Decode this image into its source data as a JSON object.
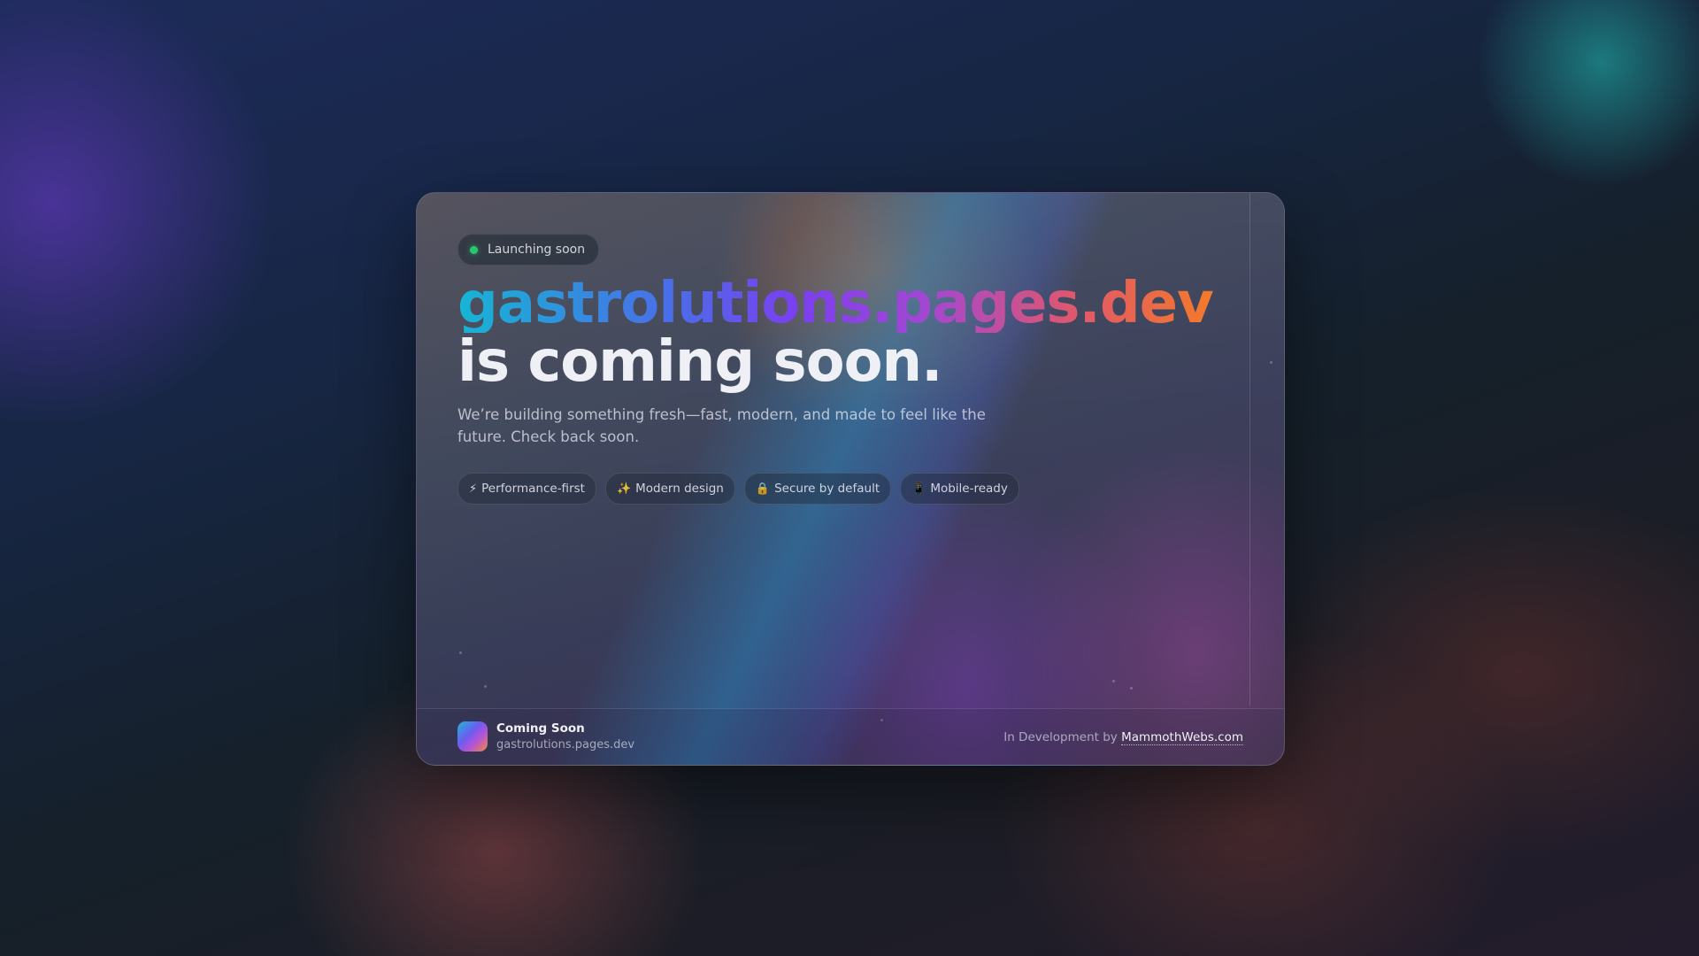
{
  "badge": {
    "label": "Launching soon"
  },
  "hero": {
    "domain": "gastrolutions.pages.dev",
    "tagline": "is coming soon.",
    "description": "We’re building something fresh—fast, modern, and made to feel like the future. Check back soon."
  },
  "features": [
    {
      "icon": "⚡",
      "label": "Performance-first"
    },
    {
      "icon": "✨",
      "label": "Modern design"
    },
    {
      "icon": "🔒",
      "label": "Secure by default"
    },
    {
      "icon": "📱",
      "label": "Mobile-ready"
    }
  ],
  "footer": {
    "title": "Coming Soon",
    "subtitle": "gastrolutions.pages.dev",
    "credit_prefix": "In Development by",
    "credit_link": "MammothWebs.com"
  },
  "colors": {
    "status_dot": "#28c76f",
    "gradient_start": "#16b5d4",
    "gradient_mid": "#7b3ff0",
    "gradient_end": "#f47a2a"
  }
}
